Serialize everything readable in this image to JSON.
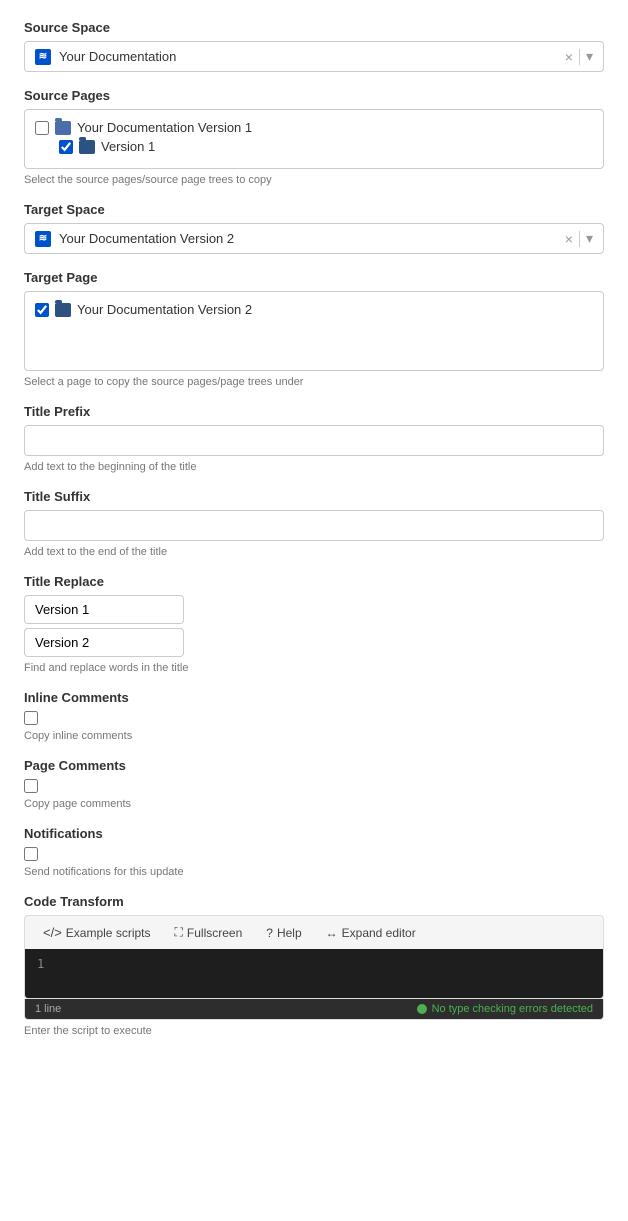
{
  "sourceSpace": {
    "label": "Source Space",
    "value": "Your Documentation",
    "clearBtn": "×",
    "dropdownBtn": "▾"
  },
  "sourcePages": {
    "label": "Source Pages",
    "items": [
      {
        "id": "item1",
        "text": "Your Documentation Version 1",
        "checked": false,
        "indented": false
      },
      {
        "id": "item2",
        "text": "Version 1",
        "checked": true,
        "indented": true
      }
    ],
    "hint": "Select the source pages/source page trees to copy"
  },
  "targetSpace": {
    "label": "Target Space",
    "value": "Your Documentation Version 2",
    "clearBtn": "×",
    "dropdownBtn": "▾"
  },
  "targetPage": {
    "label": "Target Page",
    "items": [
      {
        "id": "tp1",
        "text": "Your Documentation Version 2",
        "checked": true,
        "indented": false
      }
    ],
    "hint": "Select a page to copy the source pages/page trees under"
  },
  "titlePrefix": {
    "label": "Title Prefix",
    "placeholder": "",
    "hint": "Add text to the beginning of the title"
  },
  "titleSuffix": {
    "label": "Title Suffix",
    "placeholder": "",
    "hint": "Add text to the end of the title"
  },
  "titleReplace": {
    "label": "Title Replace",
    "findValue": "Version 1",
    "replaceValue": "Version 2",
    "hint": "Find and replace words in the title"
  },
  "inlineComments": {
    "label": "Inline Comments",
    "checked": false,
    "hint": "Copy inline comments"
  },
  "pageComments": {
    "label": "Page Comments",
    "checked": false,
    "hint": "Copy page comments"
  },
  "notifications": {
    "label": "Notifications",
    "checked": false,
    "hint": "Send notifications for this update"
  },
  "codeTransform": {
    "label": "Code Transform",
    "toolbar": {
      "exampleScripts": "Example scripts",
      "fullscreen": "Fullscreen",
      "help": "Help",
      "expandEditor": "Expand editor"
    },
    "lineNumber": "1",
    "statusLeft": "1 line",
    "statusRight": "No type checking errors detected",
    "hint": "Enter the script to execute"
  }
}
